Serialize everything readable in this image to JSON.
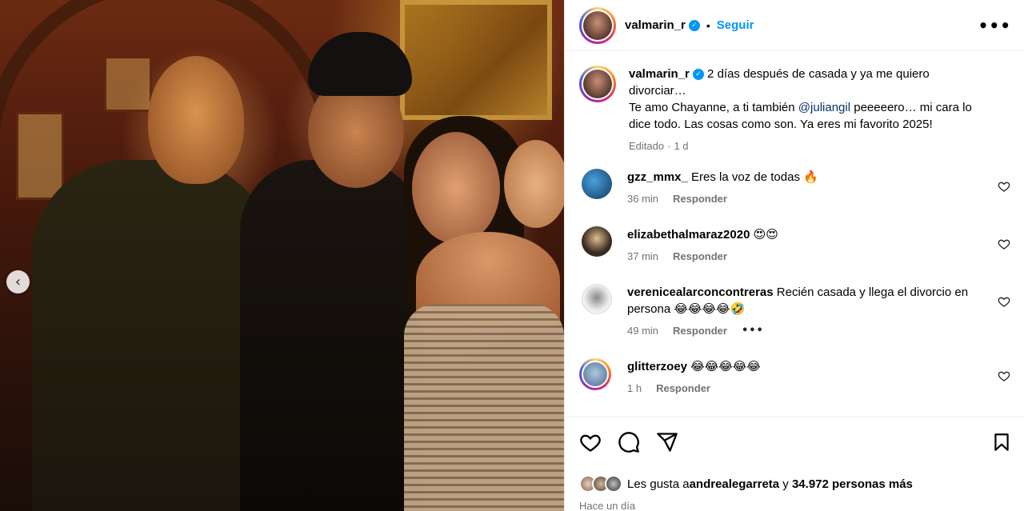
{
  "post": {
    "username": "valmarin_r",
    "follow_label": "Seguir",
    "separator": "•",
    "more_label": "•••",
    "prev_label": "‹"
  },
  "caption": {
    "username": "valmarin_r",
    "text_before": " 2 días después de casada y ya me quiero divorciar…",
    "text_line2_before": "Te amo Chayanne, a ti también ",
    "mention": "@juliangil",
    "text_after": " peeeeero… mi cara lo dice todo. Las cosas como son. Ya eres mi favorito 2025!",
    "edited": "Editado",
    "time": "1 d"
  },
  "comments": [
    {
      "username": "gzz_mmx_",
      "text": " Eres la voz de todas 🔥",
      "time": "36 min",
      "reply": "Responder",
      "avatar_color": "#1e5a8a"
    },
    {
      "username": "elizabethalmaraz2020",
      "text": " 😍😍",
      "time": "37 min",
      "reply": "Responder",
      "avatar_color": "#3a2a20"
    },
    {
      "username": "verenicealarconcontreras",
      "text": " Recién casada y llega el divorcio en persona 😂😂😂😂🤣",
      "time": "49 min",
      "reply": "Responder",
      "avatar_color": "#d8d8d8",
      "more": "•••"
    },
    {
      "username": "glitterzoey",
      "text": " 😂😂😂😂😂",
      "time": "1 h",
      "reply": "Responder",
      "avatar_color": "#6a8ab0"
    }
  ],
  "likes": {
    "prefix": "Les gusta a ",
    "user": "andrealegarreta",
    "middle": " y ",
    "count": "34.972 personas más"
  },
  "posted_ago": "Hace un día",
  "colors": {
    "accent": "#0095f6",
    "muted": "#737373",
    "mention": "#00376b"
  },
  "icons": [
    "heart-icon",
    "comment-icon",
    "share-icon",
    "bookmark-icon",
    "chevron-left-icon",
    "verified-icon",
    "more-icon"
  ]
}
